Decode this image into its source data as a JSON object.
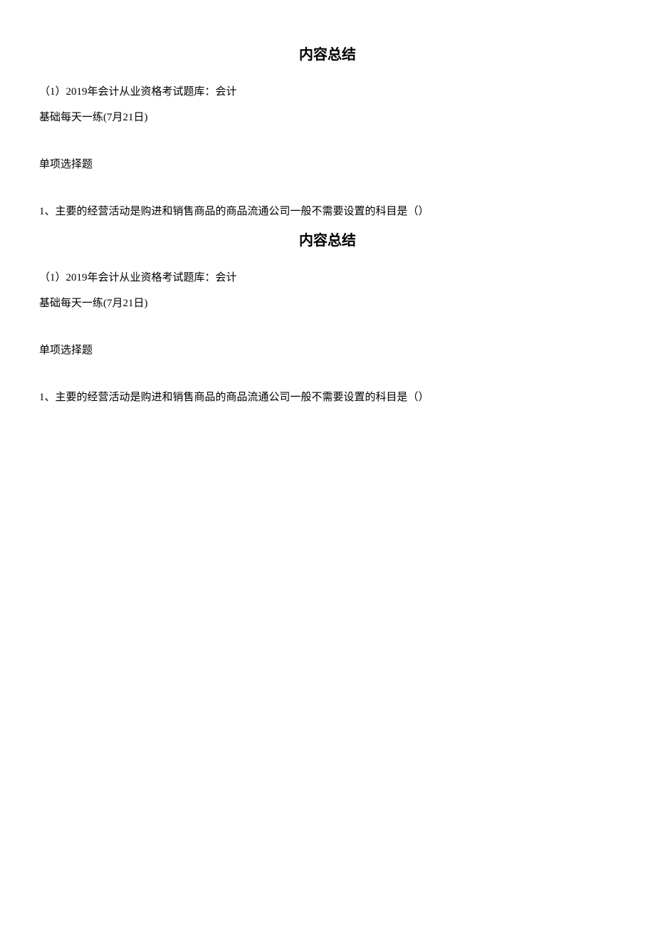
{
  "sections": [
    {
      "title": "内容总结",
      "line1": "（1）2019年会计从业资格考试题库：会计",
      "line2": "基础每天一练(7月21日)",
      "line3": "单项选择题",
      "line4": "1、主要的经营活动是购进和销售商品的商品流通公司一般不需要设置的科目是（）"
    },
    {
      "title": "内容总结",
      "line1": "（1）2019年会计从业资格考试题库：会计",
      "line2": "基础每天一练(7月21日)",
      "line3": "单项选择题",
      "line4": "1、主要的经营活动是购进和销售商品的商品流通公司一般不需要设置的科目是（）"
    }
  ]
}
